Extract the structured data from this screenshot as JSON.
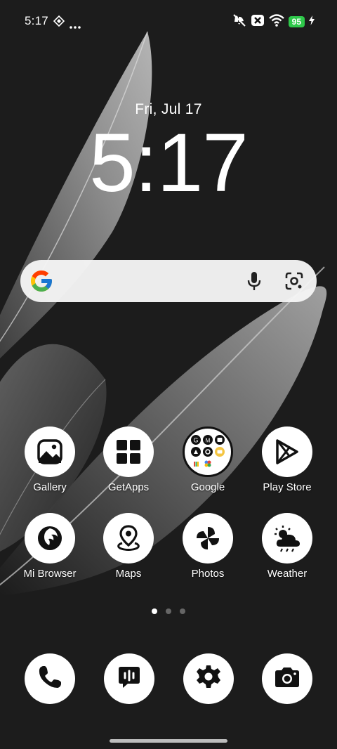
{
  "status_bar": {
    "time": "5:17",
    "battery_level": "95",
    "colors": {
      "battery": "#2ec84a"
    }
  },
  "clock_widget": {
    "date": "Fri, Jul 17",
    "time": "5:17"
  },
  "search_bar": {
    "icons": [
      "google-g-icon",
      "microphone-icon",
      "lens-camera-icon"
    ]
  },
  "apps": [
    {
      "label": "Gallery",
      "icon": "gallery-icon"
    },
    {
      "label": "GetApps",
      "icon": "getapps-icon"
    },
    {
      "label": "Google",
      "icon": "google-folder-icon"
    },
    {
      "label": "Play Store",
      "icon": "play-store-icon"
    },
    {
      "label": "Mi Browser",
      "icon": "mi-browser-icon"
    },
    {
      "label": "Maps",
      "icon": "maps-icon"
    },
    {
      "label": "Photos",
      "icon": "photos-icon"
    },
    {
      "label": "Weather",
      "icon": "weather-icon"
    }
  ],
  "page_indicator": {
    "pages": 3,
    "current": 1
  },
  "dock": [
    {
      "icon": "phone-icon"
    },
    {
      "icon": "messages-icon"
    },
    {
      "icon": "settings-icon"
    },
    {
      "icon": "camera-icon"
    }
  ]
}
